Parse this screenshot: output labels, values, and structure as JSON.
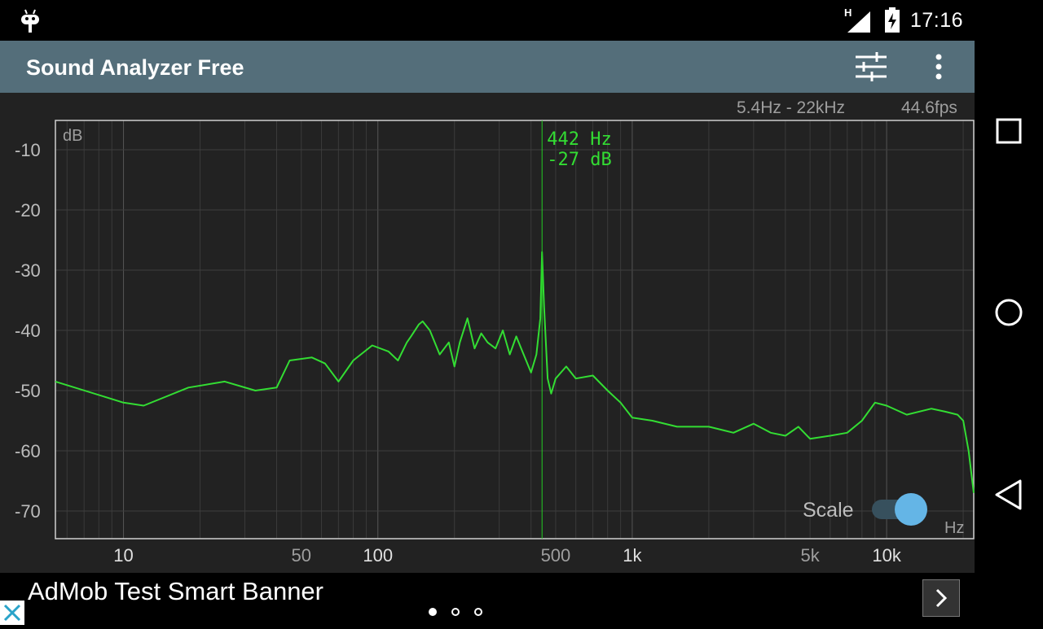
{
  "status": {
    "time": "17:16",
    "network": "H",
    "icons": [
      "android-debug-icon",
      "signal-icon",
      "battery-charging-icon"
    ]
  },
  "app": {
    "title": "Sound Analyzer Free",
    "actions": [
      "tune-icon",
      "more-vert-icon"
    ]
  },
  "spectrum": {
    "range_text": "5.4Hz - 22kHz",
    "fps_text": "44.6fps",
    "y_unit": "dB",
    "x_unit": "Hz",
    "y_ticks": [
      "-10",
      "-20",
      "-30",
      "-40",
      "-50",
      "-60",
      "-70"
    ],
    "x_ticks": [
      "10",
      "50",
      "100",
      "500",
      "1k",
      "5k",
      "10k"
    ],
    "cursor": {
      "freq_label": "442 Hz",
      "db_label": "-27 dB",
      "freq_hz": 442,
      "db": -27
    },
    "scale_label": "Scale",
    "scale_on": true,
    "colors": {
      "trace": "#33dd33",
      "cursor": "#22cc22",
      "background": "#222222",
      "grid": "#444444"
    }
  },
  "chart_data": {
    "type": "line",
    "title": "",
    "xlabel": "Hz",
    "ylabel": "dB",
    "x_scale": "log",
    "xlim": [
      5.4,
      22000
    ],
    "ylim": [
      -75,
      -5
    ],
    "grid": true,
    "series": [
      {
        "x": [
          5.4,
          10,
          12,
          18,
          25,
          33,
          40,
          45,
          55,
          62,
          70,
          80,
          95,
          110,
          120,
          130,
          135,
          145,
          150,
          160,
          175,
          190,
          200,
          210,
          225,
          240,
          255,
          270,
          290,
          310,
          330,
          350,
          370,
          400,
          420,
          435,
          442,
          450,
          465,
          480,
          500,
          550,
          600,
          700,
          800,
          900,
          1000,
          1200,
          1500,
          2000,
          2500,
          3000,
          3500,
          4000,
          4500,
          5000,
          6000,
          7000,
          8000,
          9000,
          10000,
          12000,
          15000,
          17000,
          19000,
          20000,
          21000,
          22000
        ],
        "y": [
          -48.5,
          -52,
          -52.5,
          -49.5,
          -48.5,
          -50,
          -49.5,
          -45,
          -44.5,
          -45.5,
          -48.5,
          -45,
          -42.5,
          -43.5,
          -45,
          -42,
          -41,
          -39,
          -38.5,
          -40,
          -44,
          -42,
          -46,
          -42,
          -38,
          -43,
          -40.5,
          -42,
          -43,
          -40,
          -44,
          -41,
          -43.5,
          -47,
          -44,
          -38,
          -27,
          -36,
          -48,
          -50.5,
          -48,
          -46,
          -48,
          -47.5,
          -50,
          -52,
          -54.5,
          -55,
          -56,
          -56,
          -57,
          -55.5,
          -57,
          -57.5,
          -56,
          -58,
          -57.5,
          -57,
          -55,
          -52,
          -52.5,
          -54,
          -53,
          -53.5,
          -54,
          -55,
          -60,
          -67
        ]
      }
    ]
  },
  "ad": {
    "text": "AdMob Test Smart Banner",
    "page_count": 3,
    "active_page": 0
  }
}
